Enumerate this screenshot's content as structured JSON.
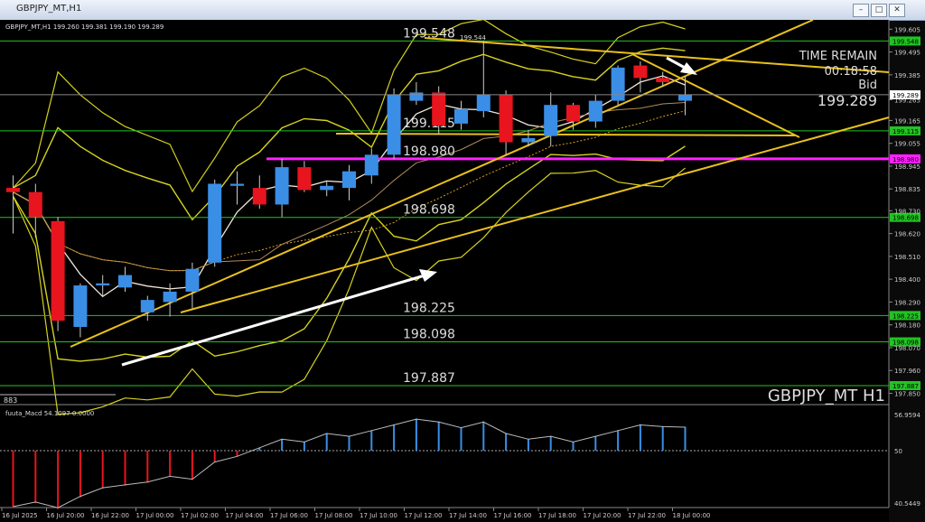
{
  "window": {
    "title": "GBPJPY_MT,H1",
    "minimize": "–",
    "restore": "□",
    "close": "✕"
  },
  "main_chart": {
    "header": "GBPJPY_MT,H1  199.260 199.381 199.190 199.289",
    "symbol_label": "GBPJPY_MT H1",
    "bottom_left_label": "883",
    "info": {
      "time_remain_label": "TIME REMAIN",
      "time_remain_value": "00:18:58",
      "bid_label": "Bid",
      "bid_value": "199.289"
    },
    "levels": [
      {
        "label": "199.548",
        "value": 199.548,
        "axis_label": "199.548"
      },
      {
        "label": "199.115",
        "value": 199.115,
        "axis_label": "199.115"
      },
      {
        "label": "198.980",
        "value": 198.98,
        "axis_label": "198.980"
      },
      {
        "label": "198.698",
        "value": 198.698,
        "axis_label": "198.698"
      },
      {
        "label": "198.225",
        "value": 198.225,
        "axis_label": "198.225"
      },
      {
        "label": "198.098",
        "value": 198.098,
        "axis_label": "198.098"
      },
      {
        "label": "197.887",
        "value": 197.887,
        "axis_label": "197.887"
      }
    ],
    "high_annotation": "199.544",
    "price_axis_ticks": [
      "199.605",
      "199.495",
      "199.385",
      "199.265",
      "199.165",
      "199.055",
      "198.945",
      "198.835",
      "198.730",
      "198.620",
      "198.510",
      "198.400",
      "198.290",
      "198.180",
      "198.070",
      "197.960",
      "197.850"
    ],
    "current_price_label": "199.289",
    "colors": {
      "bull": "#3a8ee6",
      "bear": "#e8141e",
      "level": "#22c322",
      "magenta": "#ff22ff",
      "trendline": "#e9c01c",
      "bollinger": "#d6d21e"
    }
  },
  "macd_panel": {
    "label": "fuuta_Macd 54.1097  0.0000",
    "axis_ticks": [
      "56.9594",
      "50",
      "40.5449"
    ],
    "colors": {
      "up": "#3a8ee6",
      "down": "#e8141e"
    }
  },
  "time_axis": [
    "16 Jul 2025",
    "16 Jul 20:00",
    "16 Jul 22:00",
    "17 Jul 00:00",
    "17 Jul 02:00",
    "17 Jul 04:00",
    "17 Jul 06:00",
    "17 Jul 08:00",
    "17 Jul 10:00",
    "17 Jul 12:00",
    "17 Jul 14:00",
    "17 Jul 16:00",
    "17 Jul 18:00",
    "17 Jul 20:00",
    "17 Jul 22:00",
    "18 Jul 00:00"
  ],
  "chart_data": [
    {
      "type": "candlestick",
      "title": "GBPJPY_MT,H1",
      "ylim": [
        197.8,
        199.65
      ],
      "candles": [
        {
          "o": 198.84,
          "h": 198.9,
          "l": 198.62,
          "c": 198.82
        },
        {
          "o": 198.82,
          "h": 198.86,
          "l": 198.6,
          "c": 198.7
        },
        {
          "o": 198.68,
          "h": 198.7,
          "l": 198.15,
          "c": 198.2
        },
        {
          "o": 198.17,
          "h": 198.38,
          "l": 198.12,
          "c": 198.37
        },
        {
          "o": 198.37,
          "h": 198.42,
          "l": 198.32,
          "c": 198.38
        },
        {
          "o": 198.36,
          "h": 198.46,
          "l": 198.34,
          "c": 198.42
        },
        {
          "o": 198.24,
          "h": 198.32,
          "l": 198.2,
          "c": 198.3
        },
        {
          "o": 198.29,
          "h": 198.38,
          "l": 198.22,
          "c": 198.34
        },
        {
          "o": 198.34,
          "h": 198.48,
          "l": 198.26,
          "c": 198.45
        },
        {
          "o": 198.48,
          "h": 198.88,
          "l": 198.46,
          "c": 198.86
        },
        {
          "o": 198.85,
          "h": 198.92,
          "l": 198.76,
          "c": 198.86
        },
        {
          "o": 198.84,
          "h": 198.9,
          "l": 198.74,
          "c": 198.76
        },
        {
          "o": 198.76,
          "h": 198.98,
          "l": 198.7,
          "c": 198.94
        },
        {
          "o": 198.94,
          "h": 198.97,
          "l": 198.82,
          "c": 198.83
        },
        {
          "o": 198.83,
          "h": 198.87,
          "l": 198.8,
          "c": 198.85
        },
        {
          "o": 198.84,
          "h": 198.95,
          "l": 198.78,
          "c": 198.92
        },
        {
          "o": 198.9,
          "h": 199.03,
          "l": 198.86,
          "c": 199.0
        },
        {
          "o": 199.0,
          "h": 199.32,
          "l": 198.98,
          "c": 199.29
        },
        {
          "o": 199.26,
          "h": 199.35,
          "l": 199.24,
          "c": 199.3
        },
        {
          "o": 199.3,
          "h": 199.33,
          "l": 199.1,
          "c": 199.14
        },
        {
          "o": 199.15,
          "h": 199.26,
          "l": 199.12,
          "c": 199.22
        },
        {
          "o": 199.21,
          "h": 199.55,
          "l": 199.18,
          "c": 199.29
        },
        {
          "o": 199.29,
          "h": 199.31,
          "l": 199.0,
          "c": 199.06
        },
        {
          "o": 199.06,
          "h": 199.12,
          "l": 199.04,
          "c": 199.08
        },
        {
          "o": 199.09,
          "h": 199.3,
          "l": 199.04,
          "c": 199.24
        },
        {
          "o": 199.24,
          "h": 199.25,
          "l": 199.12,
          "c": 199.16
        },
        {
          "o": 199.16,
          "h": 199.29,
          "l": 199.13,
          "c": 199.26
        },
        {
          "o": 199.26,
          "h": 199.43,
          "l": 199.24,
          "c": 199.42
        },
        {
          "o": 199.43,
          "h": 199.45,
          "l": 199.3,
          "c": 199.37
        },
        {
          "o": 199.37,
          "h": 199.4,
          "l": 199.33,
          "c": 199.35
        },
        {
          "o": 199.26,
          "h": 199.38,
          "l": 199.19,
          "c": 199.289
        }
      ]
    },
    {
      "type": "bar",
      "title": "fuuta_Macd 54.1097  0.0000",
      "ylim": [
        40.5449,
        56.9594
      ],
      "values": [
        40.2,
        41.0,
        40.0,
        42.0,
        43.5,
        44.0,
        44.5,
        45.5,
        45.0,
        48.0,
        49.0,
        50.5,
        52.0,
        51.5,
        53.0,
        52.5,
        53.5,
        54.5,
        55.5,
        55.0,
        54.0,
        55.0,
        53.0,
        52.0,
        52.5,
        51.5,
        52.5,
        53.5,
        54.5,
        54.2,
        54.1
      ]
    }
  ]
}
